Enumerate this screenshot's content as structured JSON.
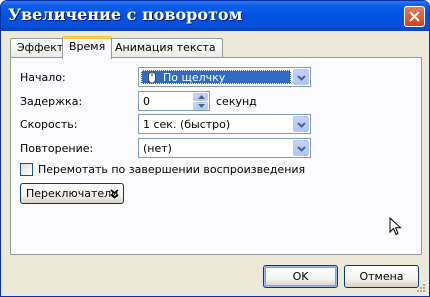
{
  "window": {
    "title": "Увеличение с поворотом"
  },
  "tabs": [
    {
      "label": "Эффект"
    },
    {
      "label": "Время"
    },
    {
      "label": "Анимация текста"
    }
  ],
  "timing": {
    "start": {
      "label": "Начало:",
      "value": "По щелчку"
    },
    "delay": {
      "label": "Задержка:",
      "value": "0",
      "unit": "секунд"
    },
    "speed": {
      "label": "Скорость:",
      "value": "1 сек. (быстро)"
    },
    "repeat": {
      "label": "Повторение:",
      "value": "(нет)"
    },
    "rewind": {
      "label": "Перемотать по завершении воспроизведения",
      "checked": false
    },
    "triggers_button": "Переключатели"
  },
  "footer": {
    "ok": "OK",
    "cancel": "Отмена"
  },
  "colors": {
    "titlebar": "#0054e3",
    "selection": "#316ac5",
    "tab_accent": "#ffc83c"
  }
}
